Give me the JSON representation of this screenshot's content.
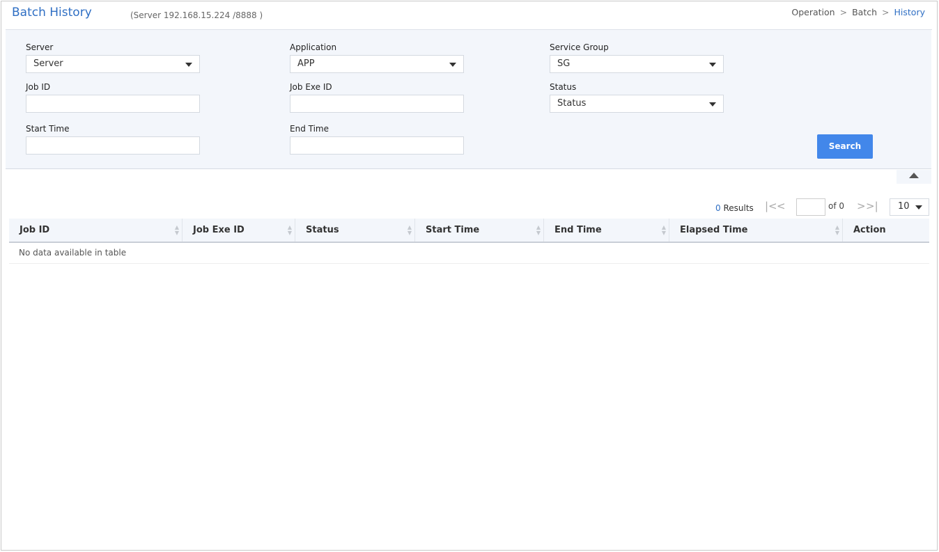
{
  "header": {
    "title": "Batch History",
    "server_info": "(Server  192.168.15.224 /8888 )",
    "breadcrumb": [
      "Operation",
      "Batch",
      "History"
    ],
    "breadcrumb_sep": ">"
  },
  "filters": {
    "server": {
      "label": "Server",
      "value": "Server"
    },
    "application": {
      "label": "Application",
      "value": "APP"
    },
    "service_group": {
      "label": "Service Group",
      "value": "SG"
    },
    "job_id": {
      "label": "Job ID",
      "value": ""
    },
    "job_exe_id": {
      "label": "Job Exe ID",
      "value": ""
    },
    "status": {
      "label": "Status",
      "value": "Status"
    },
    "start_time": {
      "label": "Start Time",
      "value": ""
    },
    "end_time": {
      "label": "End Time",
      "value": ""
    },
    "search_label": "Search"
  },
  "pagination": {
    "count": "0",
    "results_label": "Results",
    "page": "",
    "of_label": "of 0",
    "page_size": "10"
  },
  "table": {
    "columns": [
      "Job ID",
      "Job Exe ID",
      "Status",
      "Start Time",
      "End Time",
      "Elapsed Time",
      "Action"
    ],
    "empty": "No data available in table"
  },
  "colors": {
    "accent": "#2f6fc4",
    "button": "#4287ea",
    "panel": "#f3f6fb"
  }
}
